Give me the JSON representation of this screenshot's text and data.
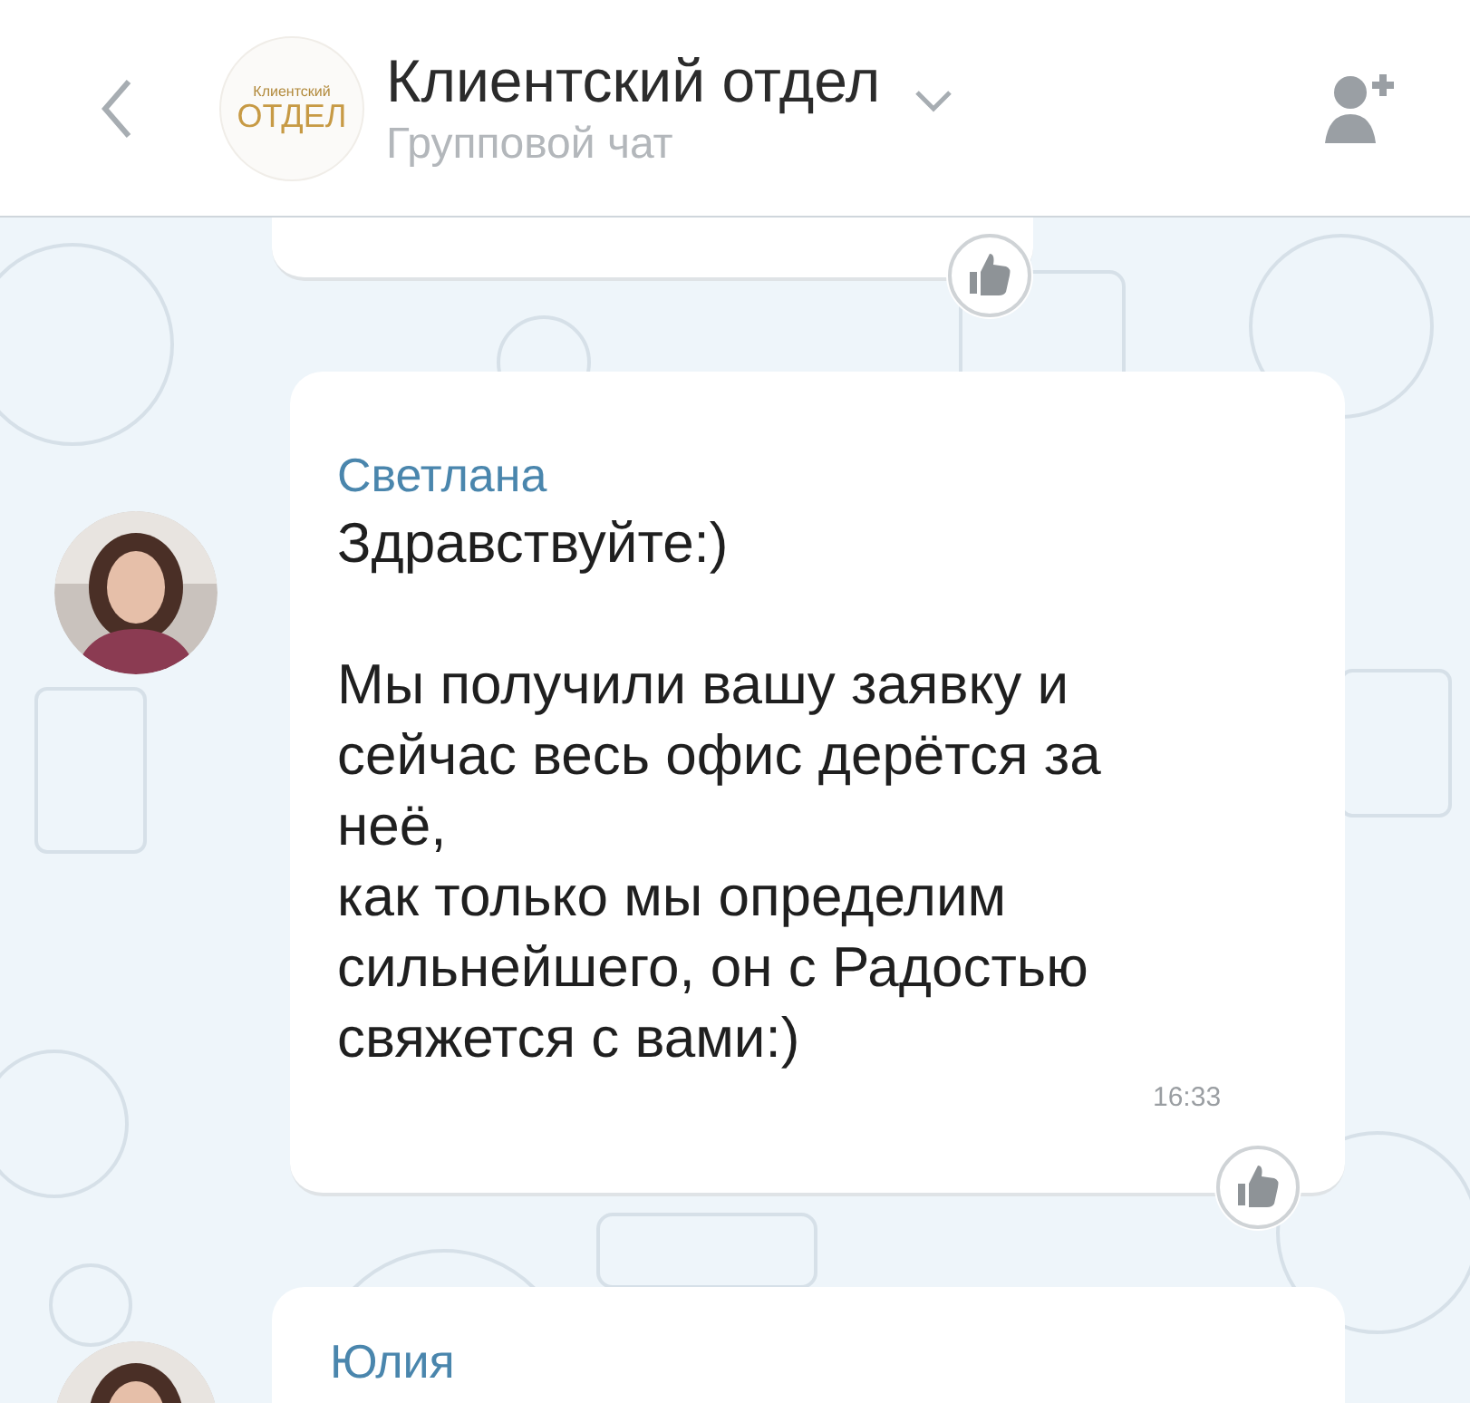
{
  "header": {
    "logo": {
      "line_1": "Клиентский",
      "line_2": "ОТДЕЛ"
    },
    "title": "Клиентский отдел",
    "subtitle": "Групповой чат"
  },
  "messages": [
    {
      "kind": "cut"
    },
    {
      "kind": "full",
      "author": "Светлана",
      "text": "Здравствуйте:)\n\nМы получили вашу заявку и\nсейчас весь офис дерётся за\nнеё,\nкак только мы определим\nсильнейшего, он с Радостью\nсвяжется с вами:)",
      "time": "16:33"
    },
    {
      "kind": "partial",
      "author": "Юлия"
    }
  ]
}
